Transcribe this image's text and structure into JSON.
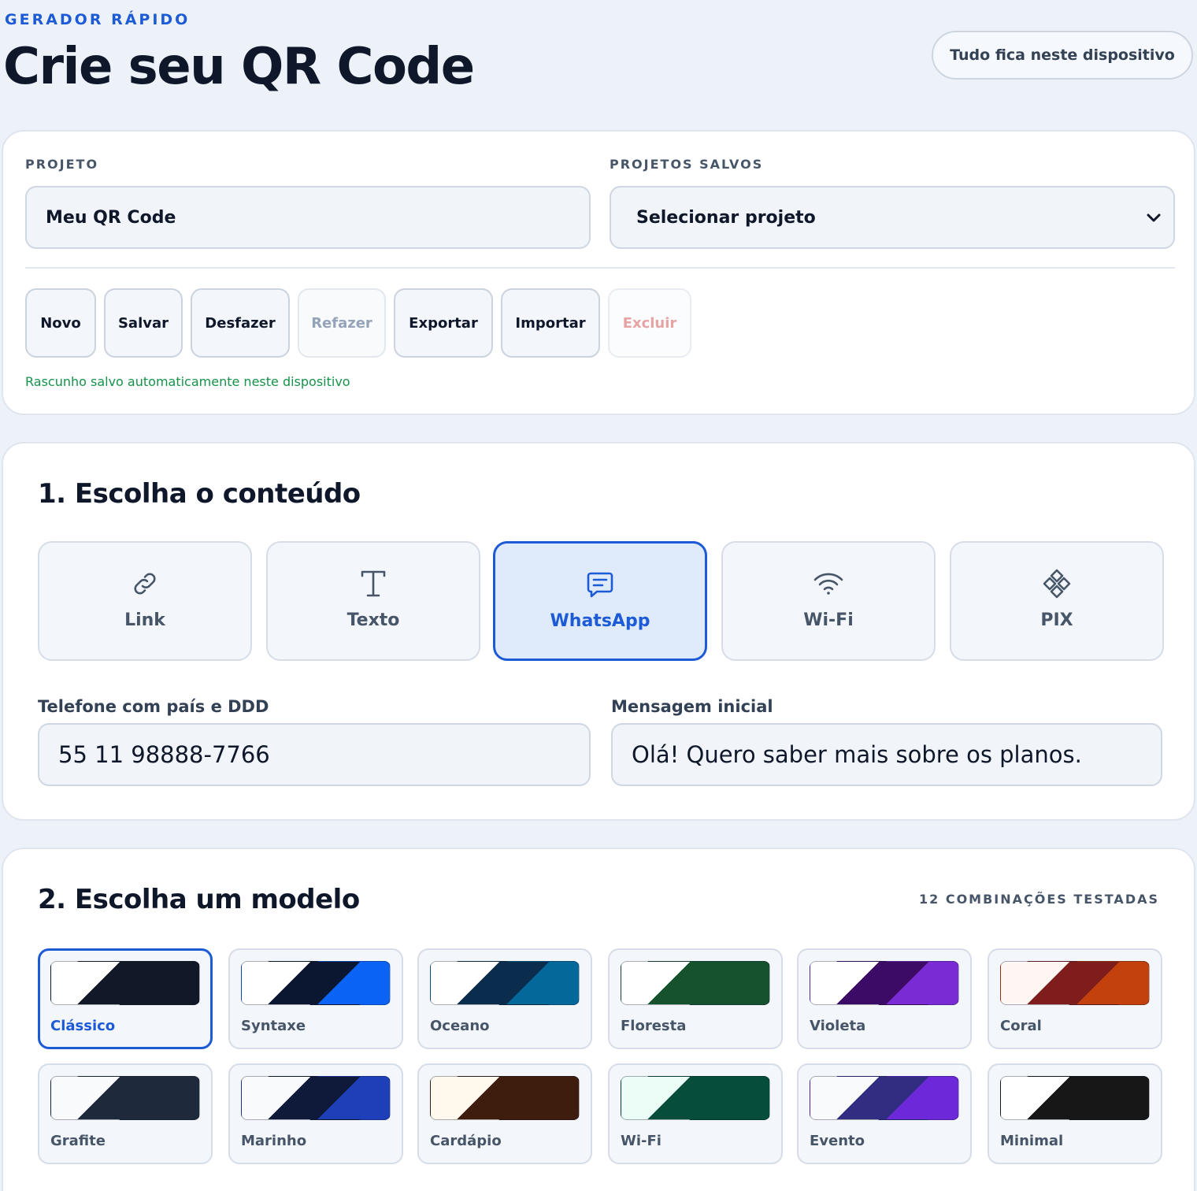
{
  "header": {
    "eyebrow": "GERADOR RÁPIDO",
    "title": "Crie seu QR Code",
    "privacy_badge": "Tudo fica neste dispositivo"
  },
  "project": {
    "project_label": "PROJETO",
    "project_name": "Meu QR Code",
    "saved_label": "PROJETOS SALVOS",
    "saved_select": "Selecionar projeto",
    "actions": [
      {
        "label": "Novo",
        "state": "enabled"
      },
      {
        "label": "Salvar",
        "state": "enabled"
      },
      {
        "label": "Desfazer",
        "state": "enabled"
      },
      {
        "label": "Refazer",
        "state": "disabled"
      },
      {
        "label": "Exportar",
        "state": "enabled"
      },
      {
        "label": "Importar",
        "state": "enabled"
      },
      {
        "label": "Excluir",
        "state": "disabled"
      }
    ],
    "draft_status": "Rascunho salvo automaticamente neste dispositivo"
  },
  "content": {
    "title": "1. Escolha o conteúdo",
    "types": [
      {
        "label": "Link",
        "icon": "link-icon",
        "selected": false
      },
      {
        "label": "Texto",
        "icon": "text-icon",
        "selected": false
      },
      {
        "label": "WhatsApp",
        "icon": "message-icon",
        "selected": true
      },
      {
        "label": "Wi-Fi",
        "icon": "wifi-icon",
        "selected": false
      },
      {
        "label": "PIX",
        "icon": "pix-icon",
        "selected": false
      }
    ],
    "phone_label": "Telefone com país e DDD",
    "phone_value": "55 11 98888-7766",
    "message_label": "Mensagem inicial",
    "message_value": "Olá! Quero saber mais sobre os planos."
  },
  "models": {
    "title": "2. Escolha um modelo",
    "count_label": "12 COMBINAÇÕES TESTADAS",
    "selected": "Clássico",
    "items": [
      {
        "name": "Clássico",
        "colors": [
          "#ffffff",
          "#111827",
          "#111827"
        ]
      },
      {
        "name": "Syntaxe",
        "colors": [
          "#ffffff",
          "#0b1730",
          "#0b63f6"
        ]
      },
      {
        "name": "Oceano",
        "colors": [
          "#ffffff",
          "#0b2d4d",
          "#05689a"
        ]
      },
      {
        "name": "Floresta",
        "colors": [
          "#ffffff",
          "#17522f",
          "#17522f"
        ]
      },
      {
        "name": "Violeta",
        "colors": [
          "#ffffff",
          "#3b0b65",
          "#7b2bd4"
        ]
      },
      {
        "name": "Coral",
        "colors": [
          "#fff7f4",
          "#7f1d1d",
          "#c2410c"
        ]
      },
      {
        "name": "Grafite",
        "colors": [
          "#f8fafc",
          "#1e293b",
          "#1e293b"
        ]
      },
      {
        "name": "Marinho",
        "colors": [
          "#f8fafc",
          "#0f1a3a",
          "#1e3fb8"
        ]
      },
      {
        "name": "Cardápio",
        "colors": [
          "#fff8ec",
          "#3f1d0e",
          "#3f1d0e"
        ]
      },
      {
        "name": "Wi-Fi",
        "colors": [
          "#ecfdf8",
          "#064e3b",
          "#064e3b"
        ]
      },
      {
        "name": "Evento",
        "colors": [
          "#f8fafc",
          "#312e81",
          "#6d28d9"
        ]
      },
      {
        "name": "Minimal",
        "colors": [
          "#ffffff",
          "#171717",
          "#171717"
        ]
      }
    ]
  },
  "colors": {
    "accent": "#1d5bd6",
    "success": "#15924a",
    "background": "#edf2f9"
  }
}
